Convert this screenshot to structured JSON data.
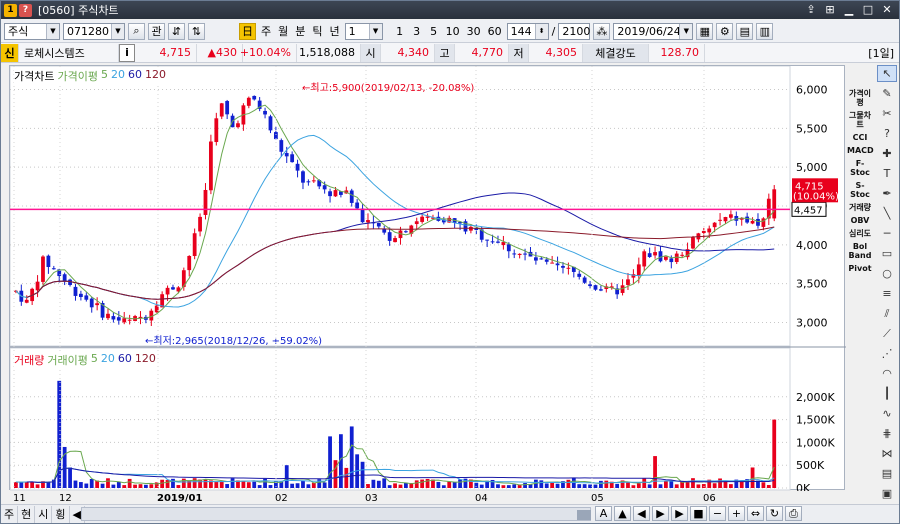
{
  "window": {
    "title": "[0560] 주식차트"
  },
  "toolbar": {
    "market": "주식",
    "code": "071280",
    "search_icon": "search-icon",
    "gwan_label": "관",
    "period_buttons": [
      "주",
      "월",
      "분",
      "틱",
      "년"
    ],
    "interval_value": "1",
    "quick_intervals": [
      "1",
      "3",
      "5",
      "10",
      "30",
      "60"
    ],
    "count_value": "144",
    "total_value": "2100",
    "date_value": "2019/06/24",
    "right_icons": [
      "grid-icon",
      "gear-icon",
      "layout-icon",
      "chart-icon"
    ]
  },
  "info": {
    "badge": "신",
    "name": "로체시스템즈",
    "info_icon": "i",
    "price": "4,715",
    "change": "▲430",
    "change_pct": "+10.04%",
    "volume": "1,518,088",
    "open_label": "시",
    "open": "4,340",
    "high_label": "고",
    "high": "4,770",
    "low_label": "저",
    "low": "4,305",
    "strength_label": "체결강도",
    "strength": "128.70",
    "period_tag": "[1일]"
  },
  "chart": {
    "price_legend": {
      "title": "가격차트",
      "ma_label": "가격이평",
      "ma_periods": [
        "5",
        "20",
        "60",
        "120"
      ]
    },
    "volume_legend": {
      "title": "거래량",
      "ma_label": "거래이평",
      "ma_periods": [
        "5",
        "20",
        "60",
        "120"
      ]
    },
    "y_ticks": [
      "6,000",
      "5,500",
      "5,000",
      "4,500",
      "4,000",
      "3,500",
      "3,000"
    ],
    "vol_ticks": [
      "2,000K",
      "1,500K",
      "1,000K",
      "500K",
      "0K"
    ],
    "x_labels": [
      "11",
      "12",
      "2019/01",
      "02",
      "03",
      "04",
      "05",
      "06"
    ],
    "high_annot": "←최고:5,900(2019/02/13, -20.08%)",
    "low_annot": "←최저:2,965(2018/12/26, +59.02%)",
    "last_price": "4,715",
    "last_pct": "(10.04%)",
    "hline_label": "4,457",
    "colors": {
      "up": "#e8001c",
      "down": "#1020d0",
      "hline": "#ff1493",
      "ma5": "#6aa84f",
      "ma20": "#3ba3e0",
      "ma60": "#1a1aa6",
      "ma120": "#8b1a2a"
    }
  },
  "chart_data": {
    "type": "candlestick",
    "ylim": [
      2800,
      6200
    ],
    "volume_ylim": [
      0,
      2500
    ],
    "high_point": 5900,
    "low_point": 2965,
    "last_close": 4715,
    "horizontal_line": 4457
  },
  "side_indicators": [
    "가격이평",
    "그물차트",
    "CCI",
    "MACD",
    "F-Stoc",
    "S-Stoc",
    "거래량",
    "OBV",
    "심리도",
    "Bol Band",
    "Pivot"
  ],
  "bottom": {
    "tabs": [
      "주",
      "현",
      "시",
      "횡"
    ],
    "scroll_left": "◀",
    "scroll_right": "▶"
  }
}
